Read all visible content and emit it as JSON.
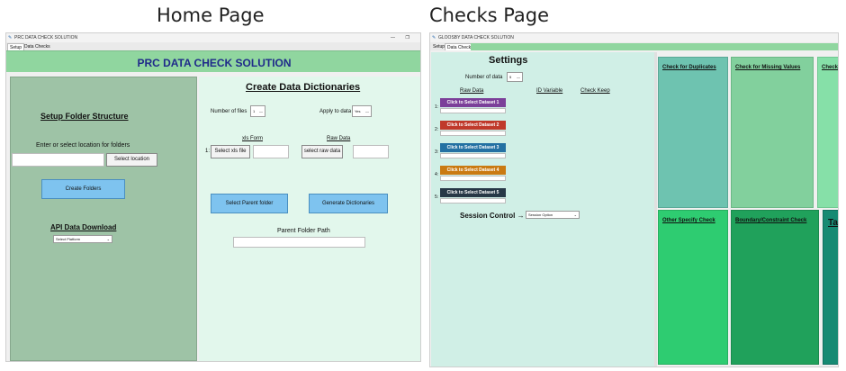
{
  "captions": {
    "home": "Home Page",
    "checks": "Checks Page"
  },
  "home": {
    "window_title": "PRC DATA CHECK SOLUTION",
    "tabs": [
      "Setup",
      "Data Checks"
    ],
    "banner": "PRC DATA CHECK SOLUTION",
    "setup_title": "Setup Folder Structure",
    "location_prompt": "Enter or select location for folders",
    "select_location": "Select location",
    "create_folders": "Create Folders",
    "api_title": "API Data Download",
    "platform_select": "Select Platform",
    "dict_title": "Create Data Dictionaries",
    "num_files_label": "Number of files",
    "num_files_value": "1",
    "apply_label": "Apply to data",
    "apply_value": "Yes",
    "xls_form_header": "xls Form",
    "raw_data_header": "Raw  Data",
    "row_num": "1:",
    "select_xls": "Select xls file",
    "select_raw": "select raw data",
    "select_parent": "Select Parent folder",
    "generate": "Generate Dictionaries",
    "parent_path_label": "Parent Folder Path"
  },
  "checks": {
    "window_title": "GLOOSBY DATA CHECK SOLUTION",
    "tabs": [
      "Setup",
      "Data Checks"
    ],
    "settings_title": "Settings",
    "num_data_label": "Number of data",
    "num_data_value": "5",
    "col_raw": "Raw Data",
    "col_id": "ID Variable",
    "col_keep": "Check Keep",
    "datasets": [
      {
        "num": "1:",
        "label": "Click to Select Dataset 1",
        "color": "#7b3f99"
      },
      {
        "num": "2:",
        "label": "Click to Select Dataset 2",
        "color": "#c0392b"
      },
      {
        "num": "3:",
        "label": "Click to Select Dataset 3",
        "color": "#2471a3"
      },
      {
        "num": "4:",
        "label": "Click to Select Dataset 4",
        "color": "#ca7a12"
      },
      {
        "num": "5:",
        "label": "Click to Select Dataset 5",
        "color": "#273746"
      }
    ],
    "session_label": "Session Control →",
    "session_option": "Session Option",
    "panels": [
      {
        "title": "Check for Duplicates",
        "color": "#6ec3b0"
      },
      {
        "title": "Check for Missing Values",
        "color": "#82d09d"
      },
      {
        "title": "Check",
        "color": "#86e0a8"
      },
      {
        "title": "Other Specify Check",
        "color": "#2ecc71"
      },
      {
        "title": "Boundary/Constraint Check",
        "color": "#20a15b"
      },
      {
        "title": "Ta",
        "color": "#178a73"
      }
    ]
  }
}
